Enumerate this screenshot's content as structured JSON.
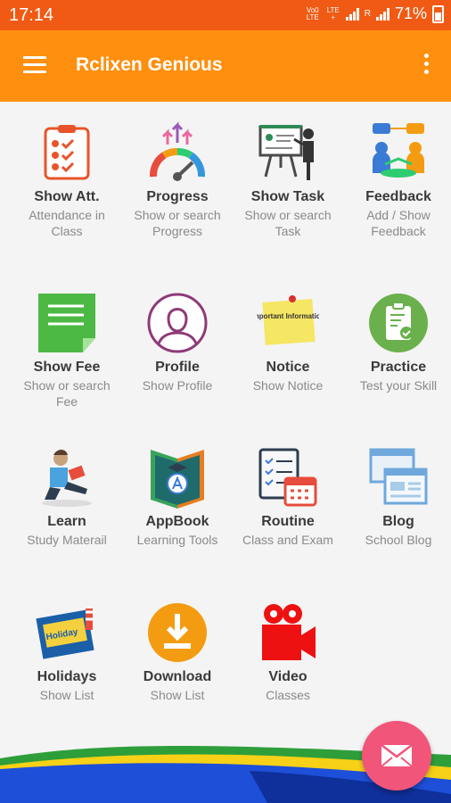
{
  "status_bar": {
    "time": "17:14",
    "net1": "Vo0 LTE",
    "net2": "LTE +",
    "net3": "R",
    "battery": "71%"
  },
  "app_bar": {
    "title": "Rclixen Genious"
  },
  "tiles": [
    {
      "title": "Show Att.",
      "subtitle": "Attendance in Class",
      "icon": "attendance-icon"
    },
    {
      "title": "Progress",
      "subtitle": "Show or search Progress",
      "icon": "progress-gauge-icon"
    },
    {
      "title": "Show Task",
      "subtitle": "Show or search Task",
      "icon": "task-presentation-icon"
    },
    {
      "title": "Feedback",
      "subtitle": "Add / Show Feedback",
      "icon": "feedback-people-icon"
    },
    {
      "title": "Show Fee",
      "subtitle": "Show or search Fee",
      "icon": "fee-document-icon"
    },
    {
      "title": "Profile",
      "subtitle": "Show Profile",
      "icon": "profile-icon"
    },
    {
      "title": "Notice",
      "subtitle": "Show Notice",
      "icon": "notice-note-icon"
    },
    {
      "title": "Practice",
      "subtitle": "Test your Skill",
      "icon": "practice-clipboard-icon"
    },
    {
      "title": "Learn",
      "subtitle": "Study Materail",
      "icon": "student-reading-icon"
    },
    {
      "title": "AppBook",
      "subtitle": "Learning Tools",
      "icon": "appbook-icon"
    },
    {
      "title": "Routine",
      "subtitle": "Class and Exam",
      "icon": "routine-calendar-icon"
    },
    {
      "title": "Blog",
      "subtitle": "School Blog",
      "icon": "blog-windows-icon"
    },
    {
      "title": "Holidays",
      "subtitle": "Show List",
      "icon": "holidays-icon"
    },
    {
      "title": "Download",
      "subtitle": "Show List",
      "icon": "download-icon"
    },
    {
      "title": "Video",
      "subtitle": "Classes",
      "icon": "video-camera-icon"
    }
  ],
  "notice_icon_text": "Important Information",
  "holiday_icon_text": "Holiday",
  "fab": {
    "icon": "mail-icon"
  },
  "colors": {
    "status_bar": "#f05a14",
    "app_bar": "#ff8f0e",
    "fab": "#f2557a"
  }
}
